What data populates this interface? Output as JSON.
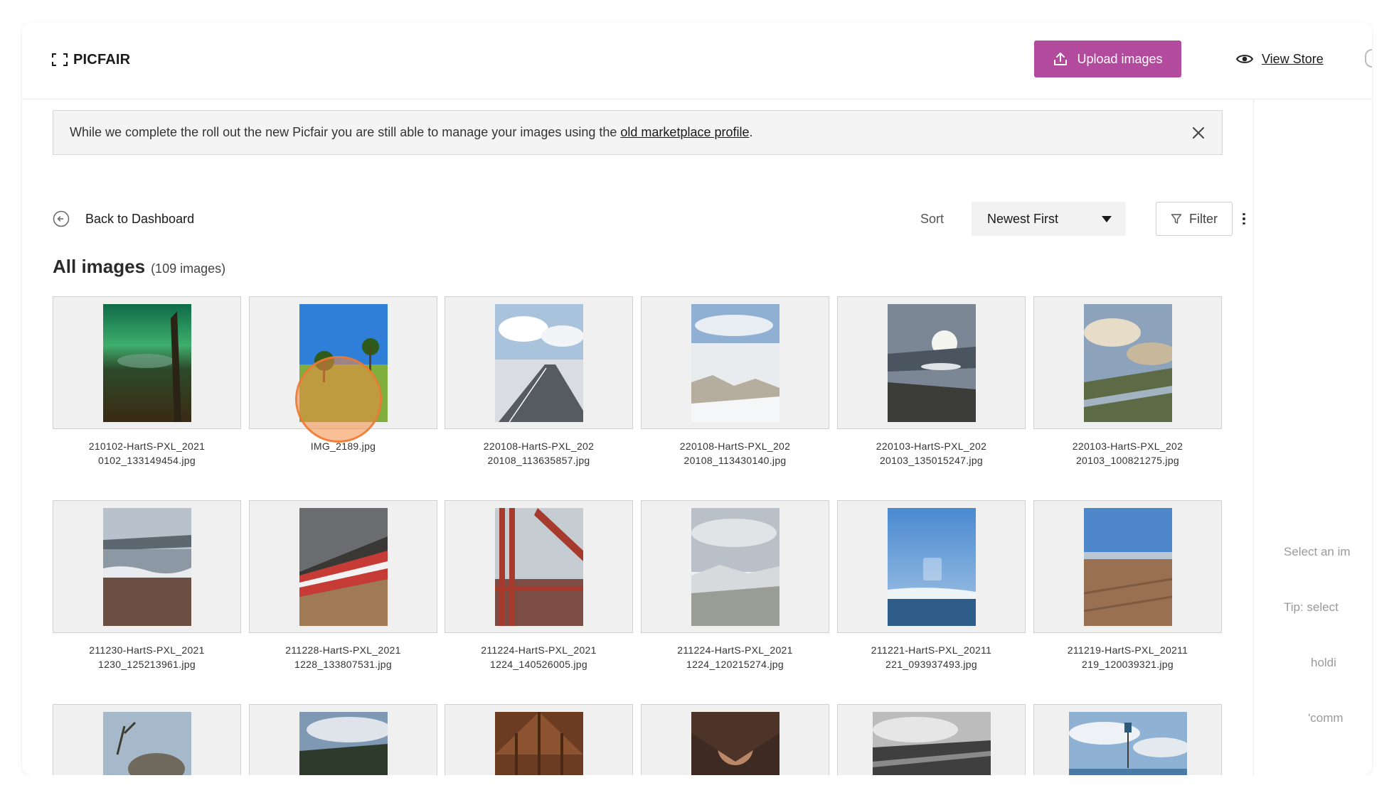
{
  "header": {
    "logo_text": "PICFAIR",
    "upload_label": "Upload images",
    "view_store_label": "View Store"
  },
  "banner": {
    "text": "While we complete the roll out the new Picfair you are still able to manage your images using the ",
    "link_text": "old marketplace profile",
    "suffix": "."
  },
  "toolbar": {
    "back_label": "Back to Dashboard",
    "sort_label": "Sort",
    "sort_value": "Newest First",
    "filter_label": "Filter"
  },
  "heading": {
    "title": "All images",
    "count": "(109 images)"
  },
  "side_panel": {
    "hint_lines": [
      "Select an im",
      "Tip: select",
      "holdi",
      "'comm"
    ]
  },
  "images": [
    {
      "line1": "210102-HartS-PXL_2021",
      "line2": "0102_133149454.jpg"
    },
    {
      "line1": "IMG_2189.jpg",
      "line2": ""
    },
    {
      "line1": "220108-HartS-PXL_202",
      "line2": "20108_113635857.jpg"
    },
    {
      "line1": "220108-HartS-PXL_202",
      "line2": "20108_113430140.jpg"
    },
    {
      "line1": "220103-HartS-PXL_202",
      "line2": "20103_135015247.jpg"
    },
    {
      "line1": "220103-HartS-PXL_202",
      "line2": "20103_100821275.jpg"
    },
    {
      "line1": "211230-HartS-PXL_2021",
      "line2": "1230_125213961.jpg"
    },
    {
      "line1": "211228-HartS-PXL_2021",
      "line2": "1228_133807531.jpg"
    },
    {
      "line1": "211224-HartS-PXL_2021",
      "line2": "1224_140526005.jpg"
    },
    {
      "line1": "211224-HartS-PXL_2021",
      "line2": "1224_120215274.jpg"
    },
    {
      "line1": "211221-HartS-PXL_20211",
      "line2": "221_093937493.jpg"
    },
    {
      "line1": "211219-HartS-PXL_20211",
      "line2": "219_120039321.jpg"
    },
    {
      "line1": "",
      "line2": ""
    },
    {
      "line1": "",
      "line2": ""
    },
    {
      "line1": "",
      "line2": ""
    },
    {
      "line1": "",
      "line2": ""
    },
    {
      "line1": "",
      "line2": ""
    },
    {
      "line1": "",
      "line2": ""
    }
  ],
  "colors": {
    "accent": "#b24b9d",
    "banner_bg": "#f4f4f4"
  }
}
